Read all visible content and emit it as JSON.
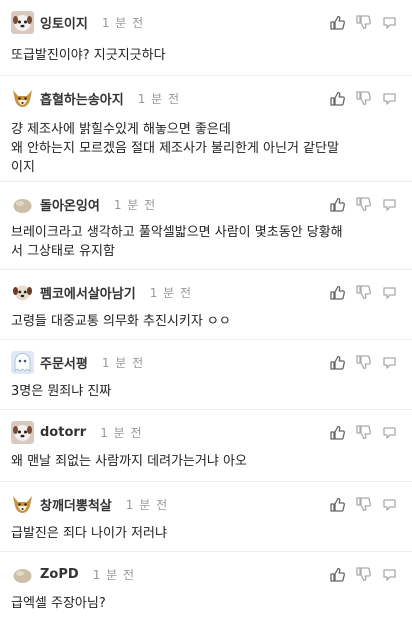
{
  "comments": [
    {
      "nick": "잉토이지",
      "time": "1 분 전",
      "avatar": "dog-white-avatar",
      "text": "또급발진이야? 지긋지긋하다"
    },
    {
      "nick": "흡혈하는송아지",
      "time": "1 분 전",
      "avatar": "fox-avatar",
      "text": "걍 제조사에 밝힐수있게 해놓으면 좋은데\n왜 안하는지 모르겠음 절대 제조사가 불리한게 아닌거 같단말\n이지"
    },
    {
      "nick": "돌아온잉여",
      "time": "1 분 전",
      "avatar": "stone-avatar",
      "text": "브레이크라고 생각하고 풀악셀밟으면 사람이 몇초동안 당황해\n서 그상태로 유지함"
    },
    {
      "nick": "펨코에서살아남기",
      "time": "1 분 전",
      "avatar": "dog-small-avatar",
      "text": "고령들 대중교통 의무화 추진시키자 ㅇㅇ"
    },
    {
      "nick": "주문서평",
      "time": "1 분 전",
      "avatar": "ghost-avatar",
      "text": "3명은 뭔죄냐 진짜"
    },
    {
      "nick": "dotorr",
      "time": "1 분 전",
      "avatar": "dog-white-avatar",
      "text": "왜 맨날 죄없는 사람까지 데려가는거냐 아오"
    },
    {
      "nick": "창깨더뽕척살",
      "time": "1 분 전",
      "avatar": "fox-avatar",
      "text": "급발진은 죄다 나이가 저러냐"
    },
    {
      "nick": "ZoPD",
      "time": "1 분 전",
      "avatar": "stone-avatar",
      "text": "급엑셀 주장아님?"
    }
  ],
  "actions": {
    "like_icon": "thumbs-up-icon",
    "dislike_icon": "thumbs-down-icon",
    "reply_icon": "reply-icon"
  }
}
